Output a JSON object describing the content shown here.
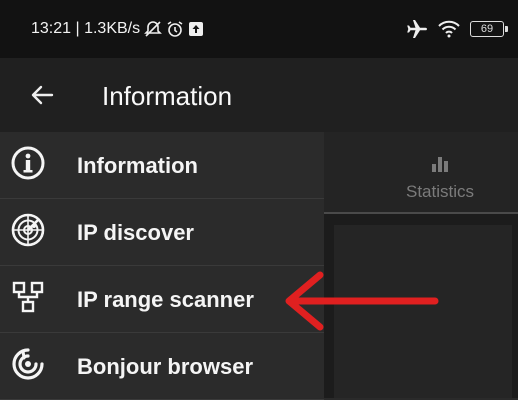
{
  "status_bar": {
    "time_speed": "13:21 | 1.3KB/s",
    "battery": "69"
  },
  "app_bar": {
    "title": "Information"
  },
  "tabs": [
    {
      "label": "Statistics",
      "icon": "bar-chart-icon"
    }
  ],
  "drawer": {
    "items": [
      {
        "label": "Information",
        "icon": "info-icon"
      },
      {
        "label": "IP discover",
        "icon": "radar-icon"
      },
      {
        "label": "IP range scanner",
        "icon": "network-icon"
      },
      {
        "label": "Bonjour browser",
        "icon": "bonjour-icon"
      }
    ]
  },
  "annotation": {
    "arrow_color": "#e02020"
  }
}
